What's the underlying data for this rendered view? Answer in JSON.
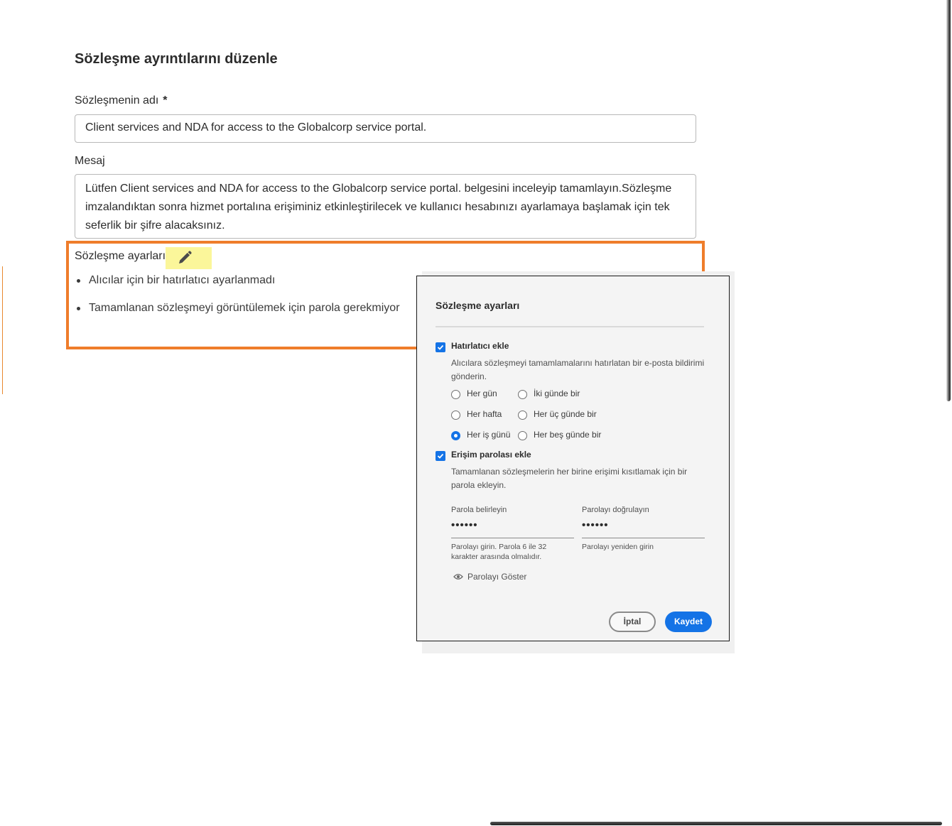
{
  "page": {
    "title": "Sözleşme ayrıntılarını düzenle",
    "name_label": "Sözleşmenin adı",
    "required_marker": "*",
    "name_value": "Client services and NDA for access to the Globalcorp service portal.",
    "message_label": "Mesaj",
    "message_value": "Lütfen Client services and NDA for access to the Globalcorp service portal. belgesini inceleyip tamamlayın.Sözleşme imzalandıktan sonra hizmet portalına erişiminiz etkinleştirilecek ve kullanıcı hesabınızı ayarlamaya başlamak için tek seferlik bir şifre alacaksınız.",
    "settings_label": "Sözleşme ayarları",
    "settings_items": [
      "Alıcılar için bir hatırlatıcı ayarlanmadı",
      "Tamamlanan sözleşmeyi görüntülemek için parola gerekmiyor"
    ]
  },
  "dialog": {
    "title": "Sözleşme ayarları",
    "reminder": {
      "checked": true,
      "label": "Hatırlatıcı ekle",
      "description": "Alıcılara sözleşmeyi tamamlamalarını hatırlatan bir e-posta bildirimi gönderin.",
      "options": [
        "Her gün",
        "İki günde bir",
        "Her hafta",
        "Her üç günde bir",
        "Her iş günü",
        "Her beş günde bir"
      ],
      "selected": "Her iş günü"
    },
    "password": {
      "checked": true,
      "label": "Erişim parolası ekle",
      "description": "Tamamlanan sözleşmelerin her birine erişimi kısıtlamak için bir parola ekleyin.",
      "set_label": "Parola belirleyin",
      "set_value": "••••••",
      "set_help": "Parolayı girin. Parola 6 ile 32 karakter arasında olmalıdır.",
      "confirm_label": "Parolayı doğrulayın",
      "confirm_value": "••••••",
      "confirm_help": "Parolayı yeniden girin",
      "show_label": "Parolayı Göster"
    },
    "cancel_label": "İptal",
    "save_label": "Kaydet"
  },
  "colors": {
    "accent": "#1473e6",
    "highlight_frame": "#ef7d2b",
    "edit_highlight": "#fbf69a"
  }
}
